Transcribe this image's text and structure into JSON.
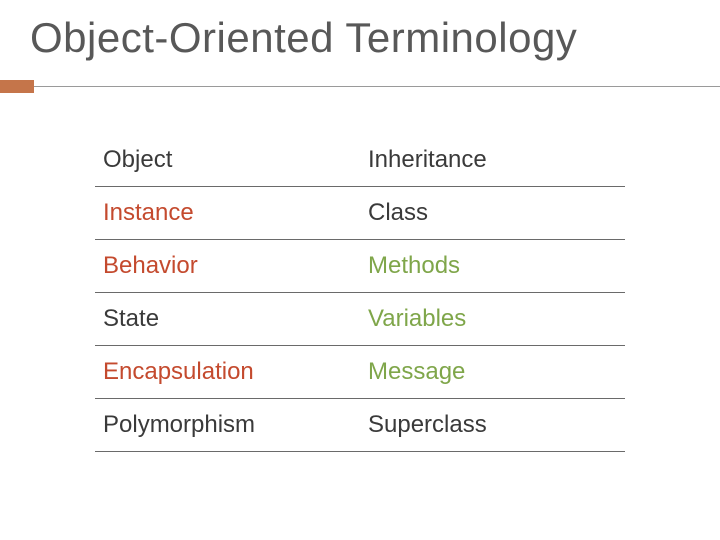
{
  "title": "Object-Oriented Terminology",
  "rows": [
    {
      "left": "Object",
      "left_color": "c-dark",
      "right": "Inheritance",
      "right_color": "c-dark"
    },
    {
      "left": "Instance",
      "left_color": "c-red",
      "right": "Class",
      "right_color": "c-dark"
    },
    {
      "left": "Behavior",
      "left_color": "c-red",
      "right": "Methods",
      "right_color": "c-green"
    },
    {
      "left": "State",
      "left_color": "c-dark",
      "right": "Variables",
      "right_color": "c-green"
    },
    {
      "left": "Encapsulation",
      "left_color": "c-red",
      "right": "Message",
      "right_color": "c-green"
    },
    {
      "left": "Polymorphism",
      "left_color": "c-dark",
      "right": "Superclass",
      "right_color": "c-dark"
    }
  ]
}
